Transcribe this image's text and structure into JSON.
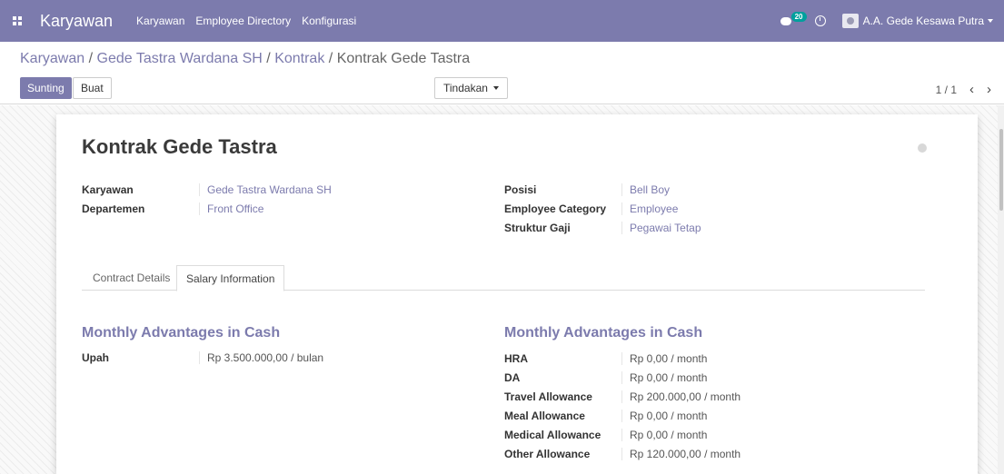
{
  "navbar": {
    "app_title": "Karyawan",
    "menu": [
      "Karyawan",
      "Employee Directory",
      "Konfigurasi"
    ],
    "chat_count": "20",
    "user_name": "A.A. Gede Kesawa Putra"
  },
  "breadcrumb": {
    "items": [
      "Karyawan",
      "Gede Tastra Wardana SH",
      "Kontrak"
    ],
    "current": "Kontrak Gede Tastra",
    "separator": "/"
  },
  "buttons": {
    "edit": "Sunting",
    "create": "Buat",
    "action": "Tindakan"
  },
  "pager": {
    "value": "1 / 1"
  },
  "record": {
    "title": "Kontrak Gede Tastra",
    "left_fields": [
      {
        "label": "Karyawan",
        "value": "Gede Tastra Wardana SH"
      },
      {
        "label": "Departemen",
        "value": "Front Office"
      }
    ],
    "right_fields": [
      {
        "label": "Posisi",
        "value": "Bell Boy"
      },
      {
        "label": "Employee Category",
        "value": "Employee"
      },
      {
        "label": "Struktur Gaji",
        "value": "Pegawai Tetap"
      }
    ]
  },
  "tabs": [
    "Contract Details",
    "Salary Information"
  ],
  "active_tab": "Salary Information",
  "salary": {
    "left_section": {
      "title": "Monthly Advantages in Cash",
      "fields": [
        {
          "label": "Upah",
          "value": "Rp 3.500.000,00 / bulan"
        }
      ]
    },
    "right_section": {
      "title": "Monthly Advantages in Cash",
      "fields": [
        {
          "label": "HRA",
          "value": "Rp 0,00 / month"
        },
        {
          "label": "DA",
          "value": "Rp 0,00 / month"
        },
        {
          "label": "Travel Allowance",
          "value": "Rp 200.000,00 / month"
        },
        {
          "label": "Meal Allowance",
          "value": "Rp 0,00 / month"
        },
        {
          "label": "Medical Allowance",
          "value": "Rp 0,00 / month"
        },
        {
          "label": "Other Allowance",
          "value": "Rp 120.000,00 / month"
        }
      ]
    }
  },
  "colors": {
    "brand": "#7c7bad",
    "badge": "#00a09d"
  }
}
